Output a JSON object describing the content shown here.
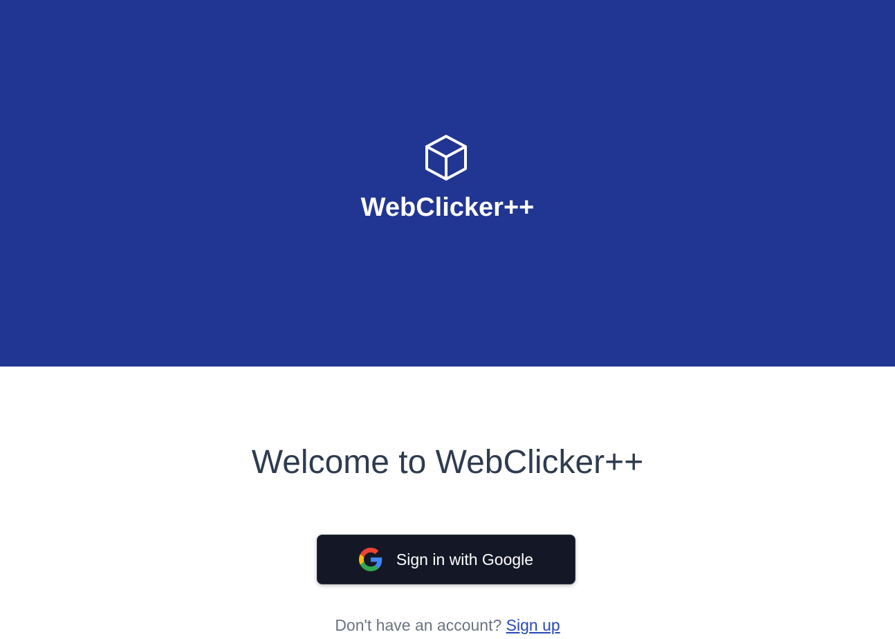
{
  "brand": {
    "name": "WebClicker++",
    "logo_icon": "cube-icon",
    "hero_color": "#213592"
  },
  "main": {
    "welcome_title": "Welcome to WebClicker++",
    "google_button": {
      "label": "Sign in with Google",
      "icon": "google-icon",
      "background": "#141826"
    },
    "signup": {
      "prompt": "Don't have an account?",
      "link_label": "Sign up",
      "link_color": "#2748b8"
    }
  }
}
